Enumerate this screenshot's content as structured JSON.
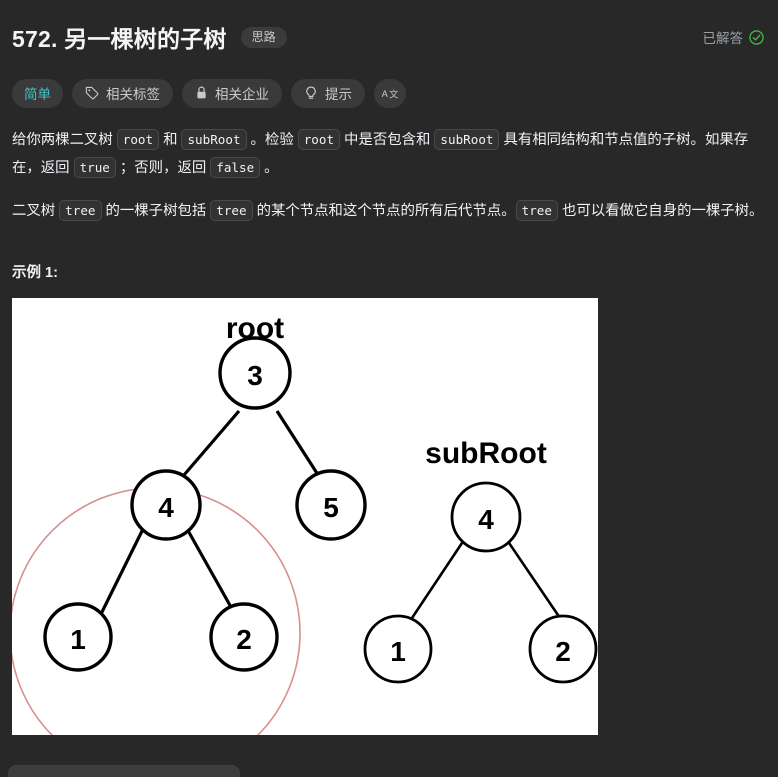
{
  "header": {
    "title": "572. 另一棵树的子树",
    "idea_badge": "思路",
    "solved_label": "已解答",
    "solved_icon": "check-circle-icon"
  },
  "chips": [
    {
      "label": "简单",
      "icon": null,
      "kind": "difficulty"
    },
    {
      "label": "相关标签",
      "icon": "tag-icon",
      "kind": "topics"
    },
    {
      "label": "相关企业",
      "icon": "lock-icon",
      "kind": "companies"
    },
    {
      "label": "提示",
      "icon": "lightbulb-icon",
      "kind": "hints"
    },
    {
      "label": "A文",
      "icon": "translate-icon",
      "kind": "translate"
    }
  ],
  "description": {
    "p1_a": "给你两棵二叉树 ",
    "p1_code1": "root",
    "p1_b": " 和 ",
    "p1_code2": "subRoot",
    "p1_c": " 。检验 ",
    "p1_code3": "root",
    "p1_d": " 中是否包含和 ",
    "p1_code4": "subRoot",
    "p1_e": " 具有相同结构和节点值的子树。如果存在，返回 ",
    "p1_code5": "true",
    "p1_f": " ；否则，返回 ",
    "p1_code6": "false",
    "p1_g": " 。",
    "p2_a": "二叉树 ",
    "p2_code1": "tree",
    "p2_b": " 的一棵子树包括 ",
    "p2_code2": "tree",
    "p2_c": " 的某个节点和这个节点的所有后代节点。",
    "p2_code3": "tree",
    "p2_d": " 也可以看做它自身的一棵子树。"
  },
  "example": {
    "label": "示例 1:",
    "figure": {
      "root_tree_label": "root",
      "subroot_tree_label": "subRoot",
      "root_nodes": [
        "3",
        "4",
        "5",
        "1",
        "2"
      ],
      "subroot_nodes": [
        "4",
        "1",
        "2"
      ],
      "highlight_color": "#d98e8e",
      "node_stroke": "#000000",
      "background": "#ffffff"
    }
  },
  "colors": {
    "page_bg": "#282828",
    "chip_bg": "#3a3a3a",
    "easy_accent": "#4ac0c0",
    "solved_accent": "#44b549",
    "text": "#eff1f6",
    "muted": "#9aa0a6"
  }
}
